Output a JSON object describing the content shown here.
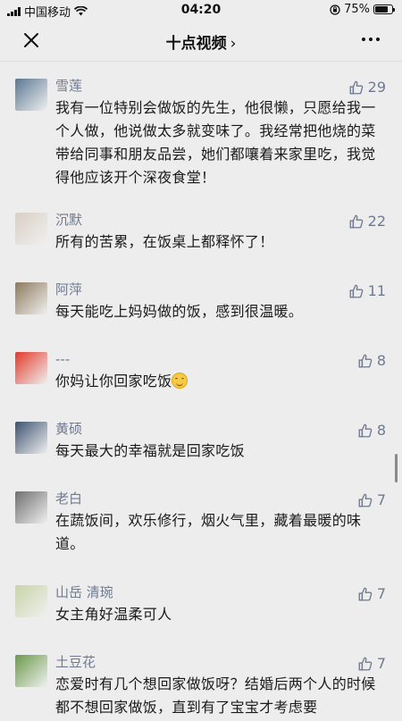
{
  "status": {
    "carrier": "中国移动",
    "time": "04:20",
    "battery": "75%",
    "battery_level": 0.75
  },
  "nav": {
    "title": "十点视频",
    "chevron": "›"
  },
  "comments": [
    {
      "nick": "雪莲",
      "likes": "29",
      "text": "我有一位特别会做饭的先生，他很懒，只愿给我一个人做，他说做太多就变味了。我经常把他烧的菜带给同事和朋友品尝，她们都嚷着来家里吃，我觉得他应该开个深夜食堂！",
      "avatar_color": "#5a7892"
    },
    {
      "nick": "沉默",
      "likes": "22",
      "text": "所有的苦累，在饭桌上都释怀了！",
      "avatar_color": "#d9cfc3"
    },
    {
      "nick": "阿萍",
      "likes": "11",
      "text": "每天能吃上妈妈做的饭，感到很温暖。",
      "avatar_color": "#8d7a5c"
    },
    {
      "nick": "---",
      "likes": "8",
      "text": "你妈让你回家吃饭",
      "avatar_color": "#e23b2a"
    },
    {
      "nick": "黄硕",
      "likes": "8",
      "text": "每天最大的幸福就是回家吃饭",
      "avatar_color": "#3d5270"
    },
    {
      "nick": "老白",
      "likes": "7",
      "text": "在蔬饭间，欢乐修行，烟火气里，藏着最暖的味道。",
      "avatar_color": "#6f6f6f"
    },
    {
      "nick": "山岳 清琬",
      "likes": "7",
      "text": "女主角好温柔可人",
      "avatar_color": "#c8d4a8"
    },
    {
      "nick": "土豆花",
      "likes": "7",
      "text": "恋爱时有几个想回家做饭呀？结婚后两个人的时候都不想回家做饭，直到有了宝宝才考虑要",
      "avatar_color": "#6a9a4a"
    }
  ]
}
